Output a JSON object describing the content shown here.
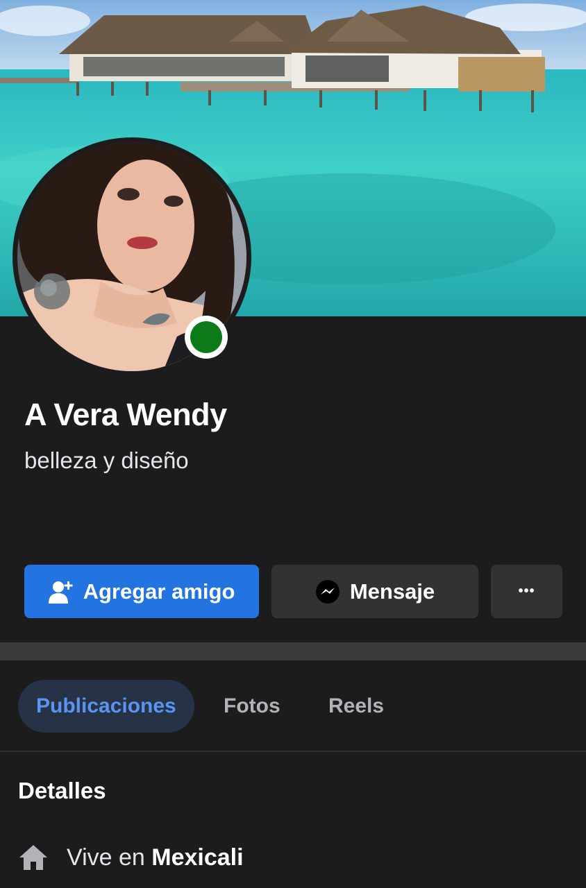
{
  "profile": {
    "name": "A Vera Wendy",
    "bio": "belleza y diseño",
    "online": true
  },
  "actions": {
    "add_friend": "Agregar amigo",
    "message": "Mensaje",
    "more": "•••"
  },
  "tabs": [
    {
      "label": "Publicaciones",
      "active": true
    },
    {
      "label": "Fotos",
      "active": false
    },
    {
      "label": "Reels",
      "active": false
    }
  ],
  "details": {
    "title": "Detalles",
    "lives_prefix": "Vive en",
    "lives_city": "Mexicali"
  },
  "icons": {
    "add_friend": "person-plus-icon",
    "message": "messenger-icon",
    "more": "ellipsis-icon",
    "home": "home-icon"
  },
  "colors": {
    "background": "#1c1c1d",
    "primary_button": "#2374e1",
    "secondary_button": "#323234",
    "active_tab_text": "#5a94f2",
    "active_tab_bg": "#263245",
    "online": "#0c7a18"
  }
}
